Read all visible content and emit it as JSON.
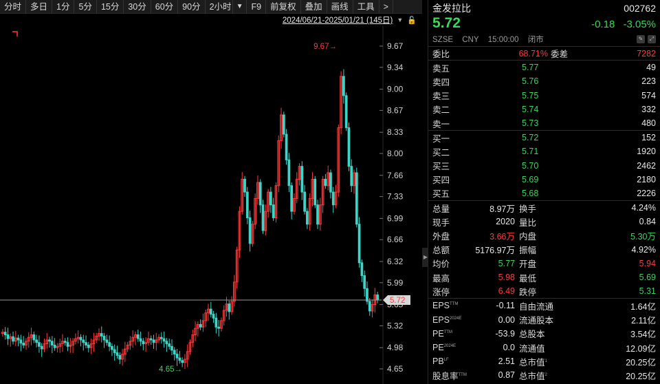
{
  "toolbar": {
    "items": [
      "分时",
      "多日",
      "1分",
      "5分",
      "15分",
      "30分",
      "60分",
      "90分",
      "2小时",
      "F9",
      "前复权",
      "叠加",
      "画线",
      "工具",
      ">"
    ],
    "active_index": -1
  },
  "range": {
    "text": "2024/06/21-2025/01/21 (145日)"
  },
  "chart_data": {
    "type": "candlestick",
    "y_ticks": [
      "9.67",
      "9.34",
      "9.00",
      "8.67",
      "8.33",
      "8.00",
      "7.66",
      "7.33",
      "6.99",
      "6.66",
      "6.32",
      "5.99",
      "5.65",
      "5.32",
      "4.98",
      "4.65"
    ],
    "ylim": [
      4.65,
      9.67
    ],
    "high_label": "9.67→",
    "low_label": "4.65→",
    "current_price_label": "5.72",
    "current_price": 5.72,
    "closes": [
      5.22,
      5.18,
      5.12,
      5.15,
      5.08,
      5.13,
      5.1,
      5.05,
      5.02,
      5.08,
      5.14,
      5.18,
      5.1,
      5.06,
      5.0,
      4.96,
      5.04,
      5.1,
      5.08,
      5.02,
      4.98,
      5.0,
      5.04,
      5.08,
      5.06,
      5.0,
      5.02,
      5.08,
      5.12,
      5.14,
      5.1,
      5.06,
      5.02,
      4.98,
      5.04,
      5.1,
      5.16,
      5.2,
      5.16,
      5.1,
      5.06,
      5.0,
      4.95,
      4.9,
      4.86,
      4.8,
      4.88,
      4.96,
      5.02,
      5.08,
      5.14,
      5.18,
      5.12,
      5.08,
      5.04,
      5.06,
      5.12,
      5.1,
      5.06,
      5.1,
      5.14,
      5.12,
      5.08,
      5.04,
      5.0,
      4.94,
      4.88,
      4.82,
      4.78,
      4.75,
      4.8,
      4.92,
      5.06,
      5.18,
      5.28,
      5.34,
      5.3,
      5.4,
      5.52,
      5.58,
      5.5,
      5.44,
      5.3,
      5.28,
      5.4,
      5.56,
      5.66,
      5.54,
      5.7,
      6.0,
      6.5,
      7.1,
      7.6,
      7.4,
      7.0,
      6.6,
      6.9,
      7.3,
      7.55,
      7.2,
      6.8,
      7.1,
      7.4,
      7.2,
      7.0,
      7.5,
      8.2,
      8.6,
      8.3,
      7.9,
      7.5,
      7.1,
      7.3,
      7.6,
      7.8,
      7.4,
      7.1,
      6.9,
      7.3,
      7.6,
      7.2,
      6.9,
      7.2,
      7.6,
      7.5,
      7.7,
      7.4,
      7.2,
      7.4,
      8.4,
      9.2,
      8.9,
      8.4,
      7.8,
      7.5,
      7.7,
      6.9,
      6.3,
      6.1,
      5.9,
      5.7,
      5.55,
      5.65,
      5.8,
      5.72
    ],
    "opens": [
      5.2,
      5.22,
      5.18,
      5.12,
      5.15,
      5.08,
      5.13,
      5.1,
      5.05,
      5.02,
      5.08,
      5.14,
      5.18,
      5.1,
      5.06,
      5.0,
      4.96,
      5.04,
      5.1,
      5.08,
      5.02,
      4.98,
      5.0,
      5.04,
      5.08,
      5.06,
      5.0,
      5.02,
      5.08,
      5.12,
      5.14,
      5.1,
      5.06,
      5.02,
      4.98,
      5.04,
      5.1,
      5.16,
      5.2,
      5.16,
      5.1,
      5.06,
      5.0,
      4.95,
      4.9,
      4.86,
      4.8,
      4.88,
      4.96,
      5.02,
      5.08,
      5.14,
      5.18,
      5.12,
      5.08,
      5.04,
      5.06,
      5.12,
      5.1,
      5.06,
      5.1,
      5.14,
      5.12,
      5.08,
      5.04,
      5.0,
      4.94,
      4.88,
      4.82,
      4.78,
      4.75,
      4.8,
      4.92,
      5.06,
      5.18,
      5.28,
      5.34,
      5.3,
      5.4,
      5.52,
      5.58,
      5.5,
      5.44,
      5.3,
      5.28,
      5.4,
      5.56,
      5.66,
      5.54,
      5.7,
      6.0,
      6.5,
      7.1,
      7.6,
      7.4,
      7.0,
      6.6,
      6.9,
      7.3,
      7.55,
      7.2,
      6.8,
      7.1,
      7.4,
      7.2,
      7.0,
      7.5,
      8.2,
      8.6,
      8.3,
      7.9,
      7.5,
      7.1,
      7.3,
      7.6,
      7.8,
      7.4,
      7.1,
      6.9,
      7.3,
      7.6,
      7.2,
      6.9,
      7.2,
      7.6,
      7.5,
      7.7,
      7.4,
      7.2,
      7.4,
      8.4,
      9.2,
      8.9,
      8.4,
      7.8,
      7.5,
      7.7,
      6.9,
      6.3,
      6.1,
      5.9,
      5.7,
      5.55,
      5.65,
      5.8
    ]
  },
  "stock": {
    "name": "金发拉比",
    "code": "002762",
    "price": "5.72",
    "change": "-0.18",
    "change_pct": "-3.05%",
    "exchange": "SZSE",
    "currency": "CNY",
    "time": "15:00:00",
    "status": "闭市"
  },
  "committee": {
    "ratio_label": "委比",
    "ratio": "68.71%",
    "diff_label": "委差",
    "diff": "7282"
  },
  "asks": [
    {
      "label": "卖五",
      "price": "5.77",
      "vol": "49"
    },
    {
      "label": "卖四",
      "price": "5.76",
      "vol": "223"
    },
    {
      "label": "卖三",
      "price": "5.75",
      "vol": "574"
    },
    {
      "label": "卖二",
      "price": "5.74",
      "vol": "332"
    },
    {
      "label": "卖一",
      "price": "5.73",
      "vol": "480"
    }
  ],
  "bids": [
    {
      "label": "买一",
      "price": "5.72",
      "vol": "152"
    },
    {
      "label": "买二",
      "price": "5.71",
      "vol": "1920"
    },
    {
      "label": "买三",
      "price": "5.70",
      "vol": "2462"
    },
    {
      "label": "买四",
      "price": "5.69",
      "vol": "2180"
    },
    {
      "label": "买五",
      "price": "5.68",
      "vol": "2226"
    }
  ],
  "stats1": [
    {
      "l1": "总量",
      "v1": "8.97万",
      "c1": "white",
      "l2": "换手",
      "v2": "4.24%",
      "c2": "white"
    },
    {
      "l1": "现手",
      "v1": "2020",
      "c1": "white",
      "l2": "量比",
      "v2": "0.84",
      "c2": "white"
    },
    {
      "l1": "外盘",
      "v1": "3.66万",
      "c1": "red",
      "l2": "内盘",
      "v2": "5.30万",
      "c2": "green"
    },
    {
      "l1": "总额",
      "v1": "5176.97万",
      "c1": "white",
      "l2": "振幅",
      "v2": "4.92%",
      "c2": "white"
    },
    {
      "l1": "均价",
      "v1": "5.77",
      "c1": "green",
      "l2": "开盘",
      "v2": "5.94",
      "c2": "red"
    },
    {
      "l1": "最高",
      "v1": "5.98",
      "c1": "red",
      "l2": "最低",
      "v2": "5.69",
      "c2": "green"
    },
    {
      "l1": "涨停",
      "v1": "6.49",
      "c1": "red",
      "l2": "跌停",
      "v2": "5.31",
      "c2": "green"
    }
  ],
  "stats2": [
    {
      "l1": "EPS",
      "s1": "TTM",
      "v1": "-0.11",
      "l2": "自由流通",
      "s2": "",
      "v2": "1.64亿"
    },
    {
      "l1": "EPS",
      "s1": "2024E",
      "v1": "0.00",
      "l2": "流通股本",
      "s2": "",
      "v2": "2.11亿"
    },
    {
      "l1": "PE",
      "s1": "TTM",
      "v1": "-53.9",
      "l2": "总股本",
      "s2": "",
      "v2": "3.54亿"
    },
    {
      "l1": "PE",
      "s1": "2024E",
      "v1": "0.0",
      "l2": "流通值",
      "s2": "",
      "v2": "12.09亿"
    },
    {
      "l1": "PB",
      "s1": "LF",
      "v1": "2.51",
      "l2": "总市值",
      "s2": "1",
      "v2": "20.25亿"
    },
    {
      "l1": "股息率",
      "s1": "TTM",
      "v1": "0.87",
      "l2": "总市值",
      "s2": "2",
      "v2": "20.25亿"
    }
  ],
  "colors": {
    "up": "#ff3b3b",
    "down": "#3dd5c8",
    "price_green": "#3dd55a"
  }
}
